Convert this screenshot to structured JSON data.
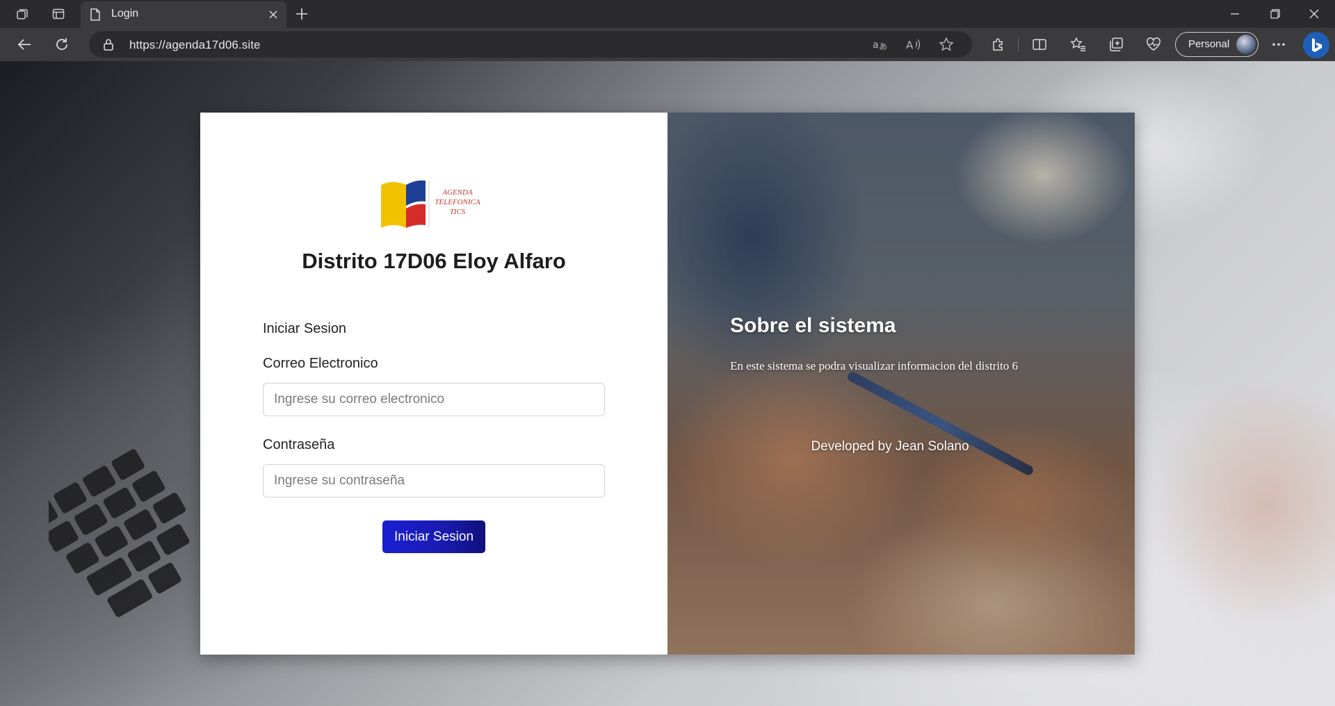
{
  "browser": {
    "tab_title": "Login",
    "url": "https://agenda17d06.site",
    "profile_label": "Personal",
    "icons": [
      "workspaces-icon",
      "tab-actions-icon",
      "page-icon",
      "close-icon",
      "new-tab-icon",
      "back-icon",
      "refresh-icon",
      "lock-icon",
      "translate-icon",
      "read-aloud-icon",
      "favorite-star-icon",
      "extensions-icon",
      "split-screen-icon",
      "favorites-icon",
      "collections-icon",
      "health-icon",
      "more-icon",
      "bing-icon",
      "minimize-icon",
      "restore-icon",
      "window-close-icon"
    ]
  },
  "login": {
    "logo_text": "AGENDA TELEFONICA TICS",
    "title": "Distrito 17D06 Eloy Alfaro",
    "form_heading": "Iniciar Sesion",
    "email_label": "Correo Electronico",
    "email_placeholder": "Ingrese su correo electronico",
    "password_label": "Contraseña",
    "password_placeholder": "Ingrese su contraseña",
    "submit_label": "Iniciar Sesion"
  },
  "about": {
    "title": "Sobre el sistema",
    "description": "En este sistema se podra visualizar informacion del distrito 6",
    "developer": "Developed by Jean Solano"
  },
  "colors": {
    "button_gradient_start": "#1a1fd1",
    "button_gradient_end": "#0f117d",
    "logo_yellow": "#f2c200",
    "logo_blue": "#1d3f95",
    "logo_red": "#d42b2b"
  }
}
